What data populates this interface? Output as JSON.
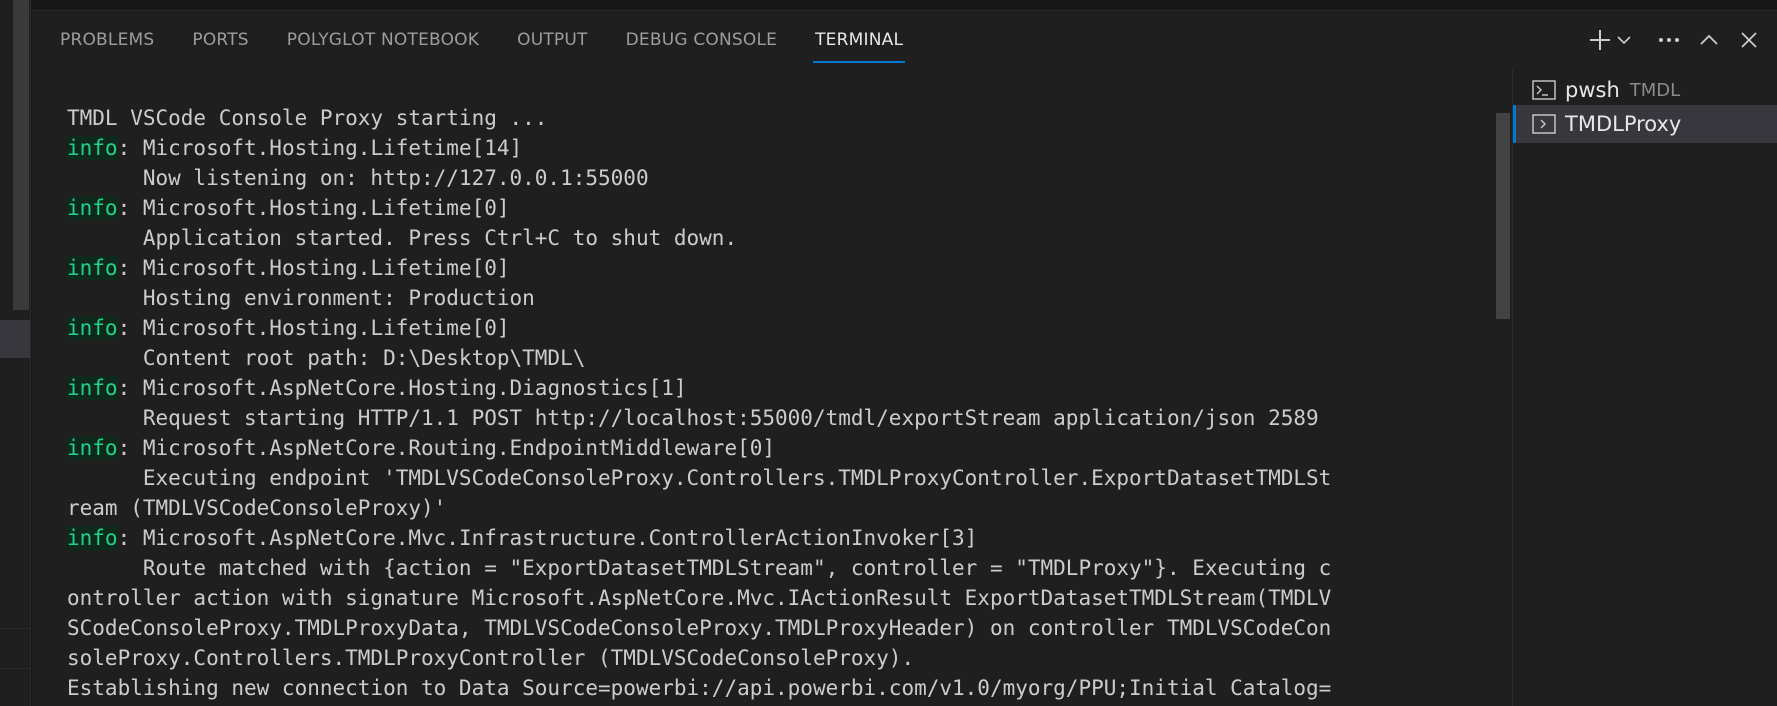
{
  "panel": {
    "tabs": [
      {
        "label": "PROBLEMS"
      },
      {
        "label": "PORTS"
      },
      {
        "label": "POLYGLOT NOTEBOOK"
      },
      {
        "label": "OUTPUT"
      },
      {
        "label": "DEBUG CONSOLE"
      },
      {
        "label": "TERMINAL"
      }
    ],
    "active_tab": "TERMINAL",
    "actions": [
      "plus-icon",
      "chevron-down-icon",
      "ellipsis-icon",
      "chevron-up-icon",
      "close-icon"
    ]
  },
  "terminal": {
    "lines": [
      {
        "prefix": "",
        "text": "TMDL VSCode Console Proxy starting ..."
      },
      {
        "prefix": "info",
        "text": ": Microsoft.Hosting.Lifetime[14]"
      },
      {
        "prefix": "",
        "text": "      Now listening on: http://127.0.0.1:55000"
      },
      {
        "prefix": "info",
        "text": ": Microsoft.Hosting.Lifetime[0]"
      },
      {
        "prefix": "",
        "text": "      Application started. Press Ctrl+C to shut down."
      },
      {
        "prefix": "info",
        "text": ": Microsoft.Hosting.Lifetime[0]"
      },
      {
        "prefix": "",
        "text": "      Hosting environment: Production"
      },
      {
        "prefix": "info",
        "text": ": Microsoft.Hosting.Lifetime[0]"
      },
      {
        "prefix": "",
        "text": "      Content root path: D:\\Desktop\\TMDL\\"
      },
      {
        "prefix": "info",
        "text": ": Microsoft.AspNetCore.Hosting.Diagnostics[1]"
      },
      {
        "prefix": "",
        "text": "      Request starting HTTP/1.1 POST http://localhost:55000/tmdl/exportStream application/json 2589"
      },
      {
        "prefix": "info",
        "text": ": Microsoft.AspNetCore.Routing.EndpointMiddleware[0]"
      },
      {
        "prefix": "",
        "text": "      Executing endpoint 'TMDLVSCodeConsoleProxy.Controllers.TMDLProxyController.ExportDatasetTMDLSt"
      },
      {
        "prefix": "",
        "text": "ream (TMDLVSCodeConsoleProxy)'"
      },
      {
        "prefix": "info",
        "text": ": Microsoft.AspNetCore.Mvc.Infrastructure.ControllerActionInvoker[3]"
      },
      {
        "prefix": "",
        "text": "      Route matched with {action = \"ExportDatasetTMDLStream\", controller = \"TMDLProxy\"}. Executing c"
      },
      {
        "prefix": "",
        "text": "ontroller action with signature Microsoft.AspNetCore.Mvc.IActionResult ExportDatasetTMDLStream(TMDLV"
      },
      {
        "prefix": "",
        "text": "SCodeConsoleProxy.TMDLProxyData, TMDLVSCodeConsoleProxy.TMDLProxyHeader) on controller TMDLVSCodeCon"
      },
      {
        "prefix": "",
        "text": "soleProxy.Controllers.TMDLProxyController (TMDLVSCodeConsoleProxy)."
      },
      {
        "prefix": "",
        "text": "Establishing new connection to Data Source=powerbi://api.powerbi.com/v1.0/myorg/PPU;Initial Catalog="
      }
    ]
  },
  "terminal_list": [
    {
      "name": "pwsh",
      "desc": "TMDL",
      "icon": "terminal-icon",
      "selected": false
    },
    {
      "name": "TMDLProxy",
      "desc": "",
      "icon": "terminal-icon",
      "selected": true
    }
  ],
  "colors": {
    "accent": "#0078d4",
    "info": "#23d18b"
  }
}
